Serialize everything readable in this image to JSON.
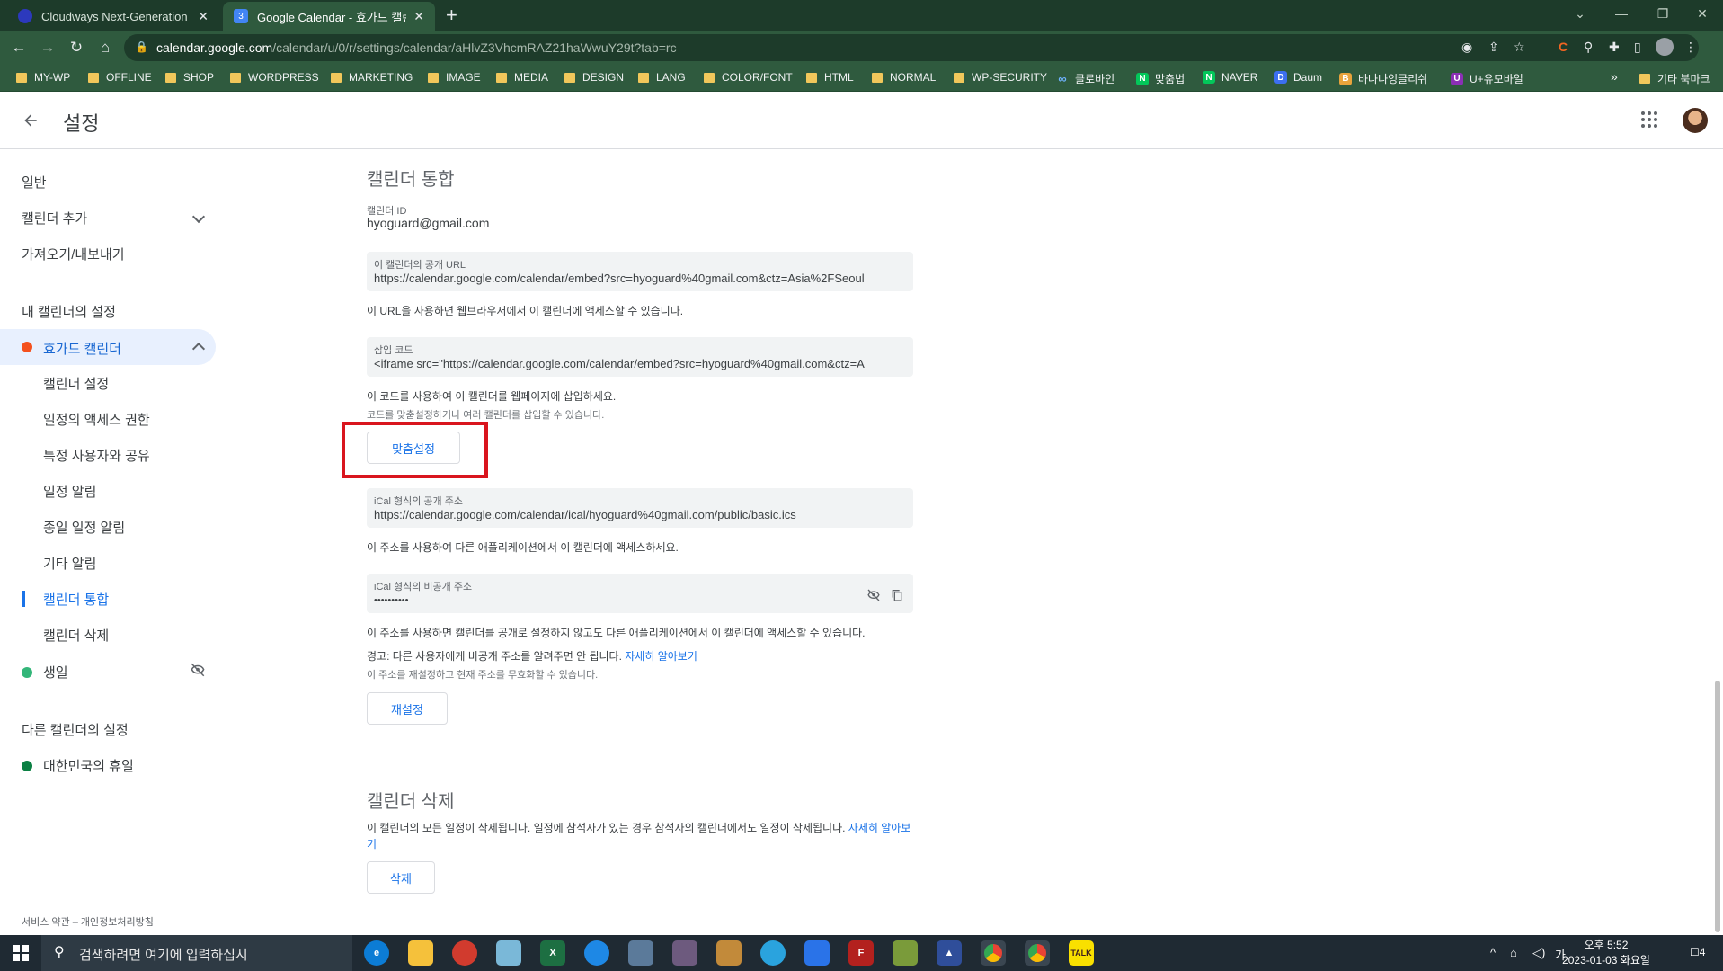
{
  "browser": {
    "tabs": [
      {
        "title": "Cloudways Next-Generation Clo",
        "active": false
      },
      {
        "title": "Google Calendar - 효가드 캘린더",
        "active": true
      }
    ],
    "new_tab": "+",
    "url_host": "calendar.google.com",
    "url_path": "/calendar/u/0/r/settings/calendar/aHlvZ3VhcmRAZ21haWwuY29t?tab=rc",
    "bookmarks": [
      "MY-WP",
      "OFFLINE",
      "SHOP",
      "WORDPRESS",
      "MARKETING",
      "IMAGE",
      "MEDIA",
      "DESIGN",
      "LANG",
      "COLOR/FONT",
      "HTML",
      "NORMAL",
      "WP-SECURITY",
      "클로바인",
      "맞춤법",
      "NAVER",
      "Daum",
      "바나나잉글리쉬",
      "U+유모바일"
    ],
    "bookmarks_more": "»",
    "other_bookmarks": "기타 북마크"
  },
  "header": {
    "title": "설정"
  },
  "sidebar": {
    "general": "일반",
    "add_calendar": "캘린더 추가",
    "import_export": "가져오기/내보내기",
    "my_calendars_heading": "내 캘린더의 설정",
    "my_calendar_name": "효가드 캘린더",
    "sub_items": [
      "캘린더 설정",
      "일정의 액세스 권한",
      "특정 사용자와 공유",
      "일정 알림",
      "종일 일정 알림",
      "기타 알림",
      "캘린더 통합",
      "캘린더 삭제"
    ],
    "birthday_calendar": "생일",
    "other_calendars_heading": "다른 캘린더의 설정",
    "holiday_calendar": "대한민국의 휴일",
    "footer": "서비스 약관 – 개인정보처리방침",
    "colors": {
      "my_calendar": "#f4511e",
      "birthday": "#33b679",
      "holiday": "#0b8043",
      "accent": "#1a73e8"
    }
  },
  "integrate": {
    "heading": "캘린더 통합",
    "calendar_id_label": "캘린더 ID",
    "calendar_id": "hyoguard@gmail.com",
    "public_url_label": "이 캘린더의 공개 URL",
    "public_url": "https://calendar.google.com/calendar/embed?src=hyoguard%40gmail.com&ctz=Asia%2FSeoul",
    "public_url_help": "이 URL을 사용하면 웹브라우저에서 이 캘린더에 액세스할 수 있습니다.",
    "embed_label": "삽입 코드",
    "embed_code": "<iframe src=\"https://calendar.google.com/calendar/embed?src=hyoguard%40gmail.com&ctz=A",
    "embed_help": "이 코드를 사용하여 이 캘린더를 웹페이지에 삽입하세요.",
    "embed_help2": "코드를 맞춤설정하거나 여러 캘린더를 삽입할 수 있습니다.",
    "customize_button": "맞춤설정",
    "ical_public_label": "iCal 형식의 공개 주소",
    "ical_public": "https://calendar.google.com/calendar/ical/hyoguard%40gmail.com/public/basic.ics",
    "ical_public_help": "이 주소를 사용하여 다른 애플리케이션에서 이 캘린더에 액세스하세요.",
    "ical_private_label": "iCal 형식의 비공개 주소",
    "ical_private": "••••••••••",
    "ical_private_help": "이 주소를 사용하면 캘린더를 공개로 설정하지 않고도 다른 애플리케이션에서 이 캘린더에 액세스할 수 있습니다.",
    "warning": "경고: 다른 사용자에게 비공개 주소를 알려주면 안 됩니다. ",
    "learn_more": "자세히 알아보기",
    "reset_help": "이 주소를 재설정하고 현재 주소를 무효화할 수 있습니다.",
    "reset_button": "재설정"
  },
  "delete": {
    "heading": "캘린더 삭제",
    "description": "이 캘린더의 모든 일정이 삭제됩니다. 일정에 참석자가 있는 경우 참석자의 캘린더에서도 일정이 삭제됩니다. ",
    "learn_more_1": "자세히 알아보",
    "learn_more_2": "기",
    "delete_button": "삭제"
  },
  "taskbar": {
    "search_placeholder": "검색하려면 여기에 입력하십시",
    "time": "오후 5:52",
    "date": "2023-01-03 화요일",
    "ime": "가",
    "notifications": "4"
  }
}
